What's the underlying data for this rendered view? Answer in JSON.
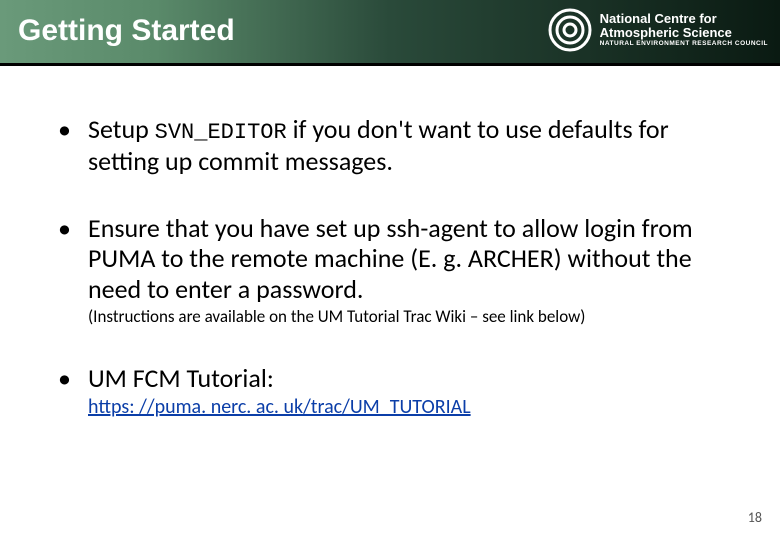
{
  "header": {
    "title": "Getting Started",
    "org": {
      "line1": "National Centre for",
      "line2": "Atmospheric Science",
      "sub": "NATURAL ENVIRONMENT RESEARCH COUNCIL"
    }
  },
  "bullets": {
    "b1": {
      "pre": "Setup ",
      "code": "SVN_EDITOR",
      "post": " if you don't want to use defaults for setting up commit messages."
    },
    "b2": {
      "main": "Ensure that you have set up ssh-agent to allow login from PUMA to the remote machine (E. g. ARCHER) without the need to enter a password.",
      "sub": "(Instructions are available on the UM Tutorial Trac Wiki – see link below)"
    },
    "b3": {
      "main": "UM FCM Tutorial:",
      "link_text": "https: //puma. nerc. ac. uk/trac/UM_TUTORIAL",
      "link_href": "https://puma.nerc.ac.uk/trac/UM_TUTORIAL"
    }
  },
  "page_number": "18"
}
